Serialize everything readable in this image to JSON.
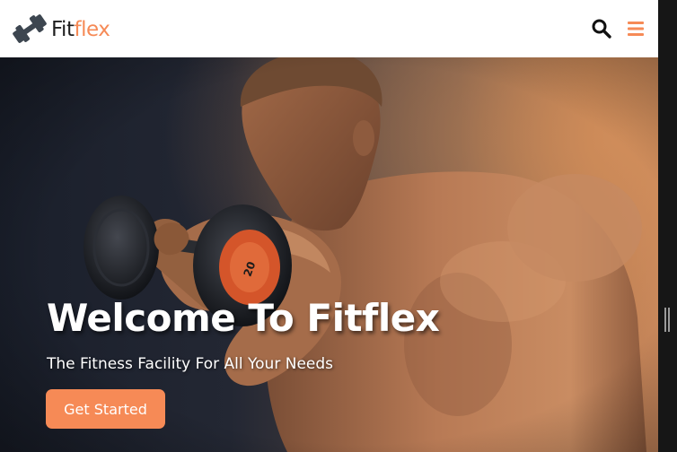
{
  "brand": {
    "name_part1": "Fit",
    "name_part2": "flex",
    "accent_color": "#f68a56",
    "icon": "dumbbell-icon"
  },
  "navbar": {
    "search_icon": "search-icon",
    "menu_icon": "hamburger-menu-icon"
  },
  "hero": {
    "title": "Welcome To Fitflex",
    "subtitle": "The Fitness Facility For All Your Needs",
    "cta_label": "Get Started",
    "plate_label": "20"
  }
}
